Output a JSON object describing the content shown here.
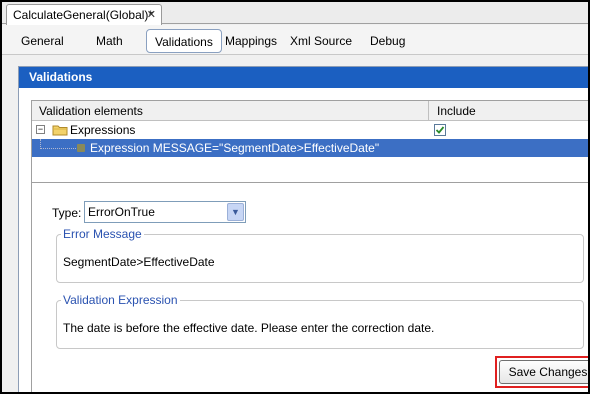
{
  "editor_tab": {
    "title": "CalculateGeneral(Global)*",
    "close_glyph": "✕"
  },
  "subtabs": [
    {
      "label": "General",
      "active": false
    },
    {
      "label": "Math",
      "active": false
    },
    {
      "label": "Validations",
      "active": true
    },
    {
      "label": "Mappings",
      "active": false
    },
    {
      "label": "Xml Source",
      "active": false
    },
    {
      "label": "Debug",
      "active": false
    }
  ],
  "panel": {
    "title": "Validations"
  },
  "grid": {
    "columns": [
      "Validation elements",
      "Include"
    ],
    "rows": [
      {
        "label": "Expressions",
        "expander": "−",
        "icon": "folder-icon",
        "included": true
      },
      {
        "label": "Expression MESSAGE=\"SegmentDate>EffectiveDate\"",
        "icon": "expression-icon",
        "selected": true
      }
    ]
  },
  "form": {
    "type_label": "Type:",
    "type_value": "ErrorOnTrue",
    "error_message": {
      "legend": "Error Message",
      "value": "SegmentDate>EffectiveDate"
    },
    "validation_expression": {
      "legend": "Validation Expression",
      "value": "The date is before the effective date. Please enter the correction date."
    },
    "save_label": "Save Changes"
  },
  "colors": {
    "panel_header": "#1b5fc1",
    "selected_row": "#3c6fc4",
    "legend_text": "#2a52b0",
    "highlight_outline": "#e02020"
  }
}
